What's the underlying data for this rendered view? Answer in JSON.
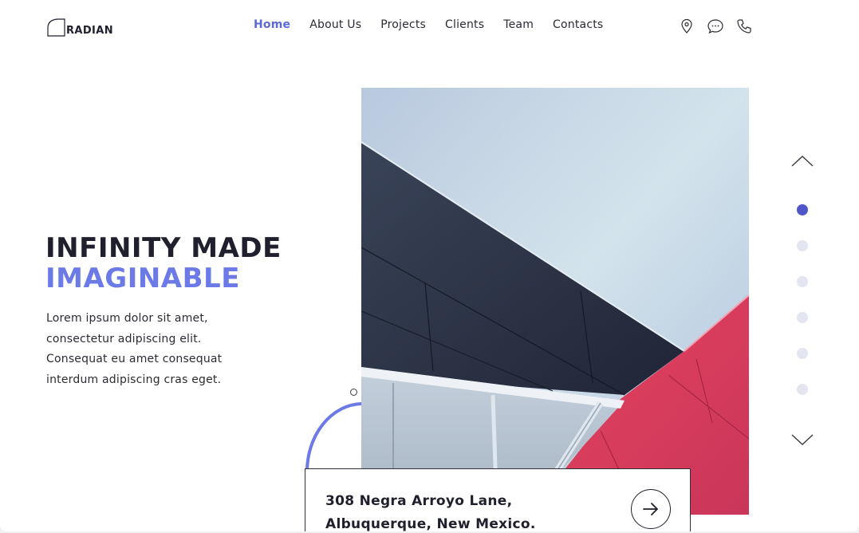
{
  "brand": {
    "name": "RADIAN"
  },
  "nav": {
    "items": [
      {
        "label": "Home",
        "active": true
      },
      {
        "label": "About Us",
        "active": false
      },
      {
        "label": "Projects",
        "active": false
      },
      {
        "label": "Clients",
        "active": false
      },
      {
        "label": "Team",
        "active": false
      },
      {
        "label": "Contacts",
        "active": false
      }
    ]
  },
  "header_icons": [
    "location-pin-icon",
    "chat-bubble-icon",
    "phone-icon"
  ],
  "hero": {
    "headline_line1": "INFINITY MADE",
    "headline_line2": "IMAGINABLE",
    "description": "Lorem ipsum dolor sit amet, consectetur adipiscing elit. Consequat eu amet consequat interdum adipiscing cras eget."
  },
  "address": {
    "line1": "308 Negra Arroyo Lane,",
    "line2": "Albuquerque, New Mexico."
  },
  "slider": {
    "total": 6,
    "active_index": 0
  },
  "colors": {
    "accent": "#6b7ae6",
    "nav_active": "#5b6ad6",
    "dot_active": "#4f56c8",
    "dot_inactive": "#e3e5f0",
    "text": "#1f1f2e"
  }
}
